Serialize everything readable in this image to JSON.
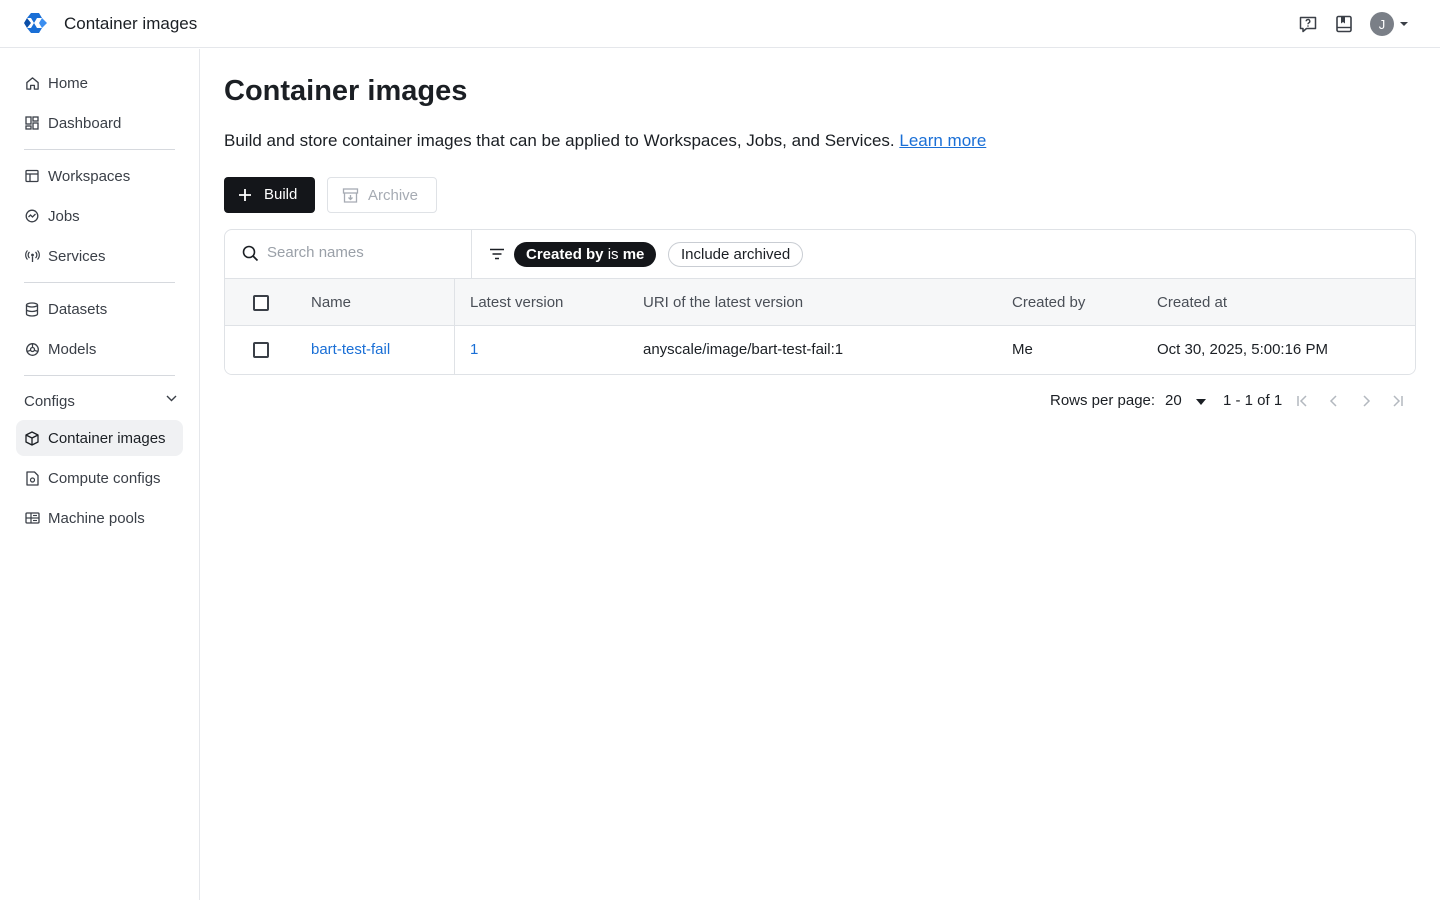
{
  "header": {
    "app_title": "Container images",
    "logo_icon": "anyscale-logo",
    "help_icon": "help-icon",
    "docs_icon": "book-icon",
    "avatar_initial": "J"
  },
  "sidebar": {
    "items": [
      {
        "label": "Home",
        "icon": "home-icon"
      },
      {
        "label": "Dashboard",
        "icon": "dashboard-icon"
      },
      {
        "label": "Workspaces",
        "icon": "workspace-icon"
      },
      {
        "label": "Jobs",
        "icon": "jobs-icon"
      },
      {
        "label": "Services",
        "icon": "services-icon"
      },
      {
        "label": "Datasets",
        "icon": "database-icon"
      },
      {
        "label": "Models",
        "icon": "models-icon"
      }
    ],
    "section": {
      "label": "Configs",
      "expanded": true
    },
    "config_items": [
      {
        "label": "Container images",
        "icon": "container-icon",
        "active": true
      },
      {
        "label": "Compute configs",
        "icon": "compute-icon"
      },
      {
        "label": "Machine pools",
        "icon": "machine-pool-icon"
      }
    ]
  },
  "main": {
    "title": "Container images",
    "subtitle": "Build and store container images that can be applied to Workspaces, Jobs, and Services.",
    "learn_more": "Learn more",
    "build_label": "Build",
    "archive_label": "Archive"
  },
  "filters": {
    "search_placeholder": "Search names",
    "chip_created_key": "Created by",
    "chip_created_op": "is",
    "chip_created_val": "me",
    "chip_archived": "Include archived"
  },
  "table": {
    "columns": [
      "Name",
      "Latest version",
      "URI of the latest version",
      "Created by",
      "Created at"
    ],
    "rows": [
      {
        "name": "bart-test-fail",
        "latest_version": "1",
        "uri": "anyscale/image/bart-test-fail:1",
        "created_by": "Me",
        "created_at": "Oct 30, 2025, 5:00:16 PM"
      }
    ]
  },
  "pagination": {
    "rows_per_page_label": "Rows per page:",
    "rows_per_page": "20",
    "range": "1 - 1 of 1"
  },
  "colors": {
    "accent_link": "#1a6fd6",
    "primary_button": "#14161a",
    "active_nav_bg": "#f0f1f3"
  }
}
